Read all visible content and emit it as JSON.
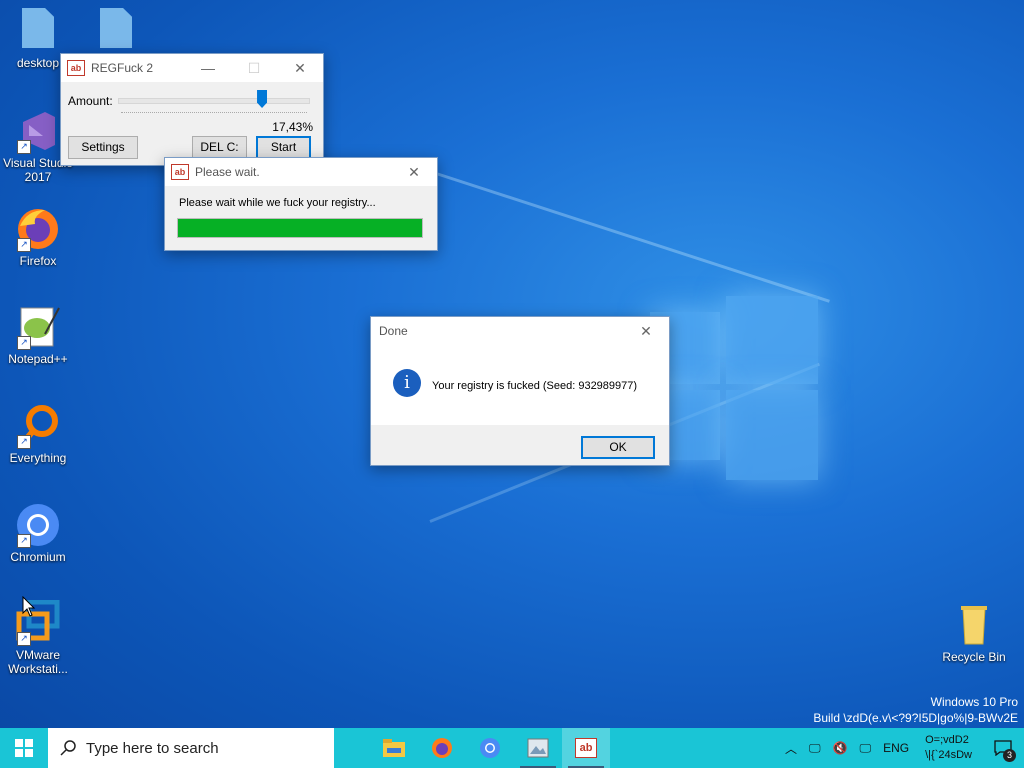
{
  "desktop": {
    "icons": [
      {
        "label": "desktop",
        "icon": "file-icon"
      },
      {
        "label": "",
        "icon": "file-icon"
      },
      {
        "label": "Visual Studio 2017",
        "icon": "visual-studio-icon"
      },
      {
        "label": "Firefox",
        "icon": "firefox-icon"
      },
      {
        "label": "Notepad++",
        "icon": "notepadpp-icon"
      },
      {
        "label": "Everything",
        "icon": "everything-search-icon"
      },
      {
        "label": "Chromium",
        "icon": "chromium-icon"
      },
      {
        "label": "VMware Workstati...",
        "icon": "vmware-icon"
      },
      {
        "label": "Recycle Bin",
        "icon": "recycle-bin-icon"
      }
    ],
    "watermark": {
      "line1": "Windows 10 Pro",
      "line2": "Build \\zdD(e.v\\<?9?I5D|go%|9-BWv2E"
    }
  },
  "regfuck": {
    "title": "REGFuck 2",
    "amount_label": "Amount:",
    "amount_value": 0.1743,
    "amount_text": "17,43%",
    "settings_label": "Settings",
    "delc_label": "DEL C:",
    "start_label": "Start"
  },
  "wait_dialog": {
    "title": "Please wait.",
    "message": "Please wait while we fuck your registry...",
    "progress": 1.0
  },
  "done_dialog": {
    "title": "Done",
    "message": "Your registry is fucked (Seed: 932989977)",
    "ok_label": "OK"
  },
  "taskbar": {
    "search_placeholder": "Type here to search",
    "apps": [
      "file-explorer-icon",
      "firefox-icon",
      "chromium-icon",
      "image-app-icon",
      "regfuck-icon"
    ],
    "lang": "ENG",
    "clock_line1": "O=;vdD2",
    "clock_line2": "\\|{`24sDw",
    "notif_count": "3"
  },
  "colors": {
    "accent": "#0078d7",
    "progress": "#06b025",
    "taskbar": "#1ac5d6"
  }
}
